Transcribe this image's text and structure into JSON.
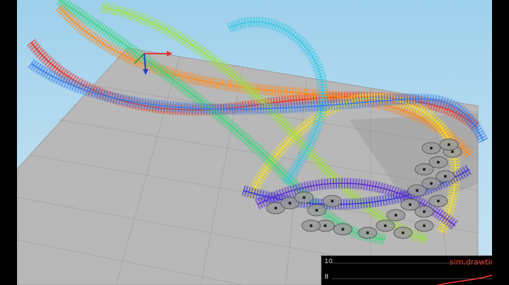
{
  "scene": {
    "description_colors": {
      "background_top": "#9ed0ec",
      "floor": "#b8b8b8",
      "grid_line": "#a9a9a9"
    },
    "axes_gizmo": {
      "x_color": "#e53935",
      "y_color": "#43a047",
      "z_color": "#1e3fd6"
    },
    "rainbow_colors": [
      "#e8321f",
      "#ff8a1a",
      "#f4e22a",
      "#9ee23c",
      "#38d67a",
      "#39c8e6",
      "#3a7ae8",
      "#3a34d6",
      "#5a2bd0"
    ]
  },
  "plot": {
    "title": "sim.drawtime",
    "ticks": [
      "10",
      "8"
    ],
    "line_color": "#ff3b30"
  }
}
